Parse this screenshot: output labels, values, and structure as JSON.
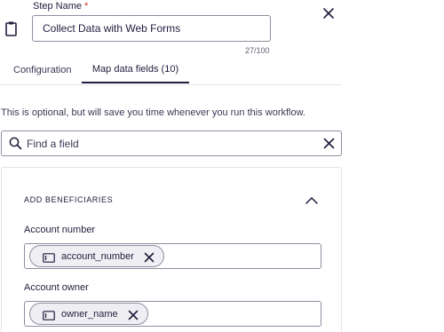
{
  "step": {
    "label": "Step Name",
    "required_mark": "*",
    "value": "Collect Data with Web Forms",
    "char_count": "27/100"
  },
  "tabs": [
    {
      "label": "Configuration",
      "active": false
    },
    {
      "label": "Map data fields (10)",
      "active": true
    }
  ],
  "optional_text": "This is optional, but will save you time whenever you run this workflow.",
  "search": {
    "placeholder": "Find a field",
    "value": ""
  },
  "section": {
    "title": "ADD BENEFICIARIES",
    "expanded": true,
    "fields": [
      {
        "label": "Account number",
        "chip": "account_number"
      },
      {
        "label": "Account owner",
        "chip": "owner_name"
      }
    ]
  },
  "icons": {
    "close": "close-icon",
    "clipboard": "clipboard-icon",
    "search": "search-icon",
    "collapse": "chevron-up-icon",
    "field": "field-icon",
    "remove": "close-icon"
  },
  "colors": {
    "text": "#1f1d3d",
    "border": "#8f8ea0",
    "required": "#d62b2b",
    "chip_bg": "#efeff3"
  }
}
